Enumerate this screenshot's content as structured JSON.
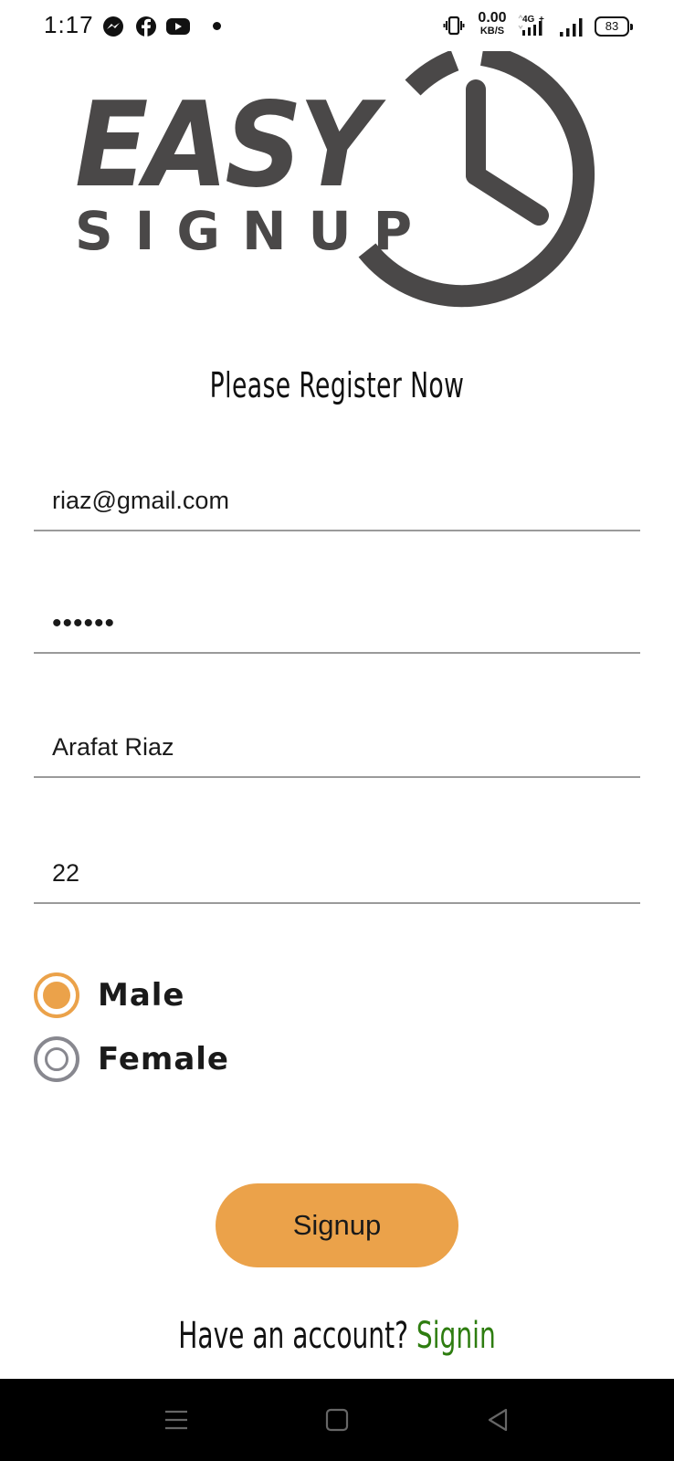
{
  "status_bar": {
    "time": "1:17",
    "speed_value": "0.00",
    "speed_unit": "KB/S",
    "network": "4G",
    "battery": "83",
    "apps": [
      "messenger-icon",
      "facebook-icon",
      "youtube-icon"
    ]
  },
  "logo": {
    "line1": "EASY",
    "line2": "SIGNUP"
  },
  "heading": "Please Register Now",
  "form": {
    "email": "riaz@gmail.com",
    "password": "••••••",
    "name": "Arafat Riaz",
    "age": "22"
  },
  "gender": {
    "options": [
      {
        "label": "Male",
        "checked": true
      },
      {
        "label": "Female",
        "checked": false
      }
    ]
  },
  "signup_button": "Signup",
  "footer": {
    "prompt": "Have an account? ",
    "link": "Signin"
  },
  "colors": {
    "accent": "#eba24a",
    "link": "#2e7d10",
    "logo": "#4a4848",
    "underline": "#9a9a9a",
    "nav_bar": "#000000"
  }
}
